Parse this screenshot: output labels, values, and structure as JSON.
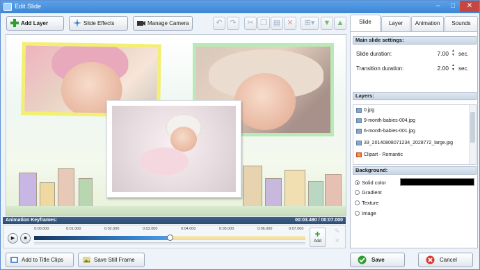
{
  "window": {
    "title": "Edit Slide",
    "controls": {
      "minimize": "–",
      "maximize": "□",
      "close": "✕"
    }
  },
  "toolbar": {
    "add_layer": "Add Layer",
    "slide_effects": "Slide Effects",
    "manage_camera": "Manage Camera",
    "icons": [
      "undo-icon",
      "redo-icon",
      "cut-icon",
      "copy-icon",
      "paste-icon",
      "delete-icon",
      "align-icon",
      "move-down-icon",
      "move-up-icon"
    ]
  },
  "keyframes": {
    "label": "Animation Keyframes:",
    "time": "00:03.490 / 00:07.000",
    "ticks": [
      "0:00.000",
      "0:01.000",
      "0:02.000",
      "0:03.000",
      "0:04.000",
      "0:05.000",
      "0:06.000",
      "0:07.000"
    ],
    "position_fraction": 0.499,
    "add_label": "Add"
  },
  "bottom": {
    "add_title_clips": "Add to Title Clips",
    "save_still_frame": "Save Still Frame",
    "save": "Save",
    "cancel": "Cancel"
  },
  "tabs": [
    {
      "label": "Slide"
    },
    {
      "label": "Layer"
    },
    {
      "label": "Animation"
    },
    {
      "label": "Sounds"
    }
  ],
  "settings": {
    "main_head": "Main slide settings:",
    "slide_duration_label": "Slide duration:",
    "slide_duration_value": "7.00",
    "transition_duration_label": "Transition duration:",
    "transition_duration_value": "2.00",
    "unit": "sec.",
    "layers_head": "Layers:",
    "layers": [
      "0.jpg",
      "9-month-babies-004.jpg",
      "6-month-babies-001.jpg",
      "33_20140808071234_2028772_large.jpg",
      "Clipart - Romantic"
    ],
    "background_head": "Background:",
    "background_options": [
      "Solid color",
      "Gradient",
      "Texture",
      "Image"
    ],
    "background_color": "#000000"
  }
}
